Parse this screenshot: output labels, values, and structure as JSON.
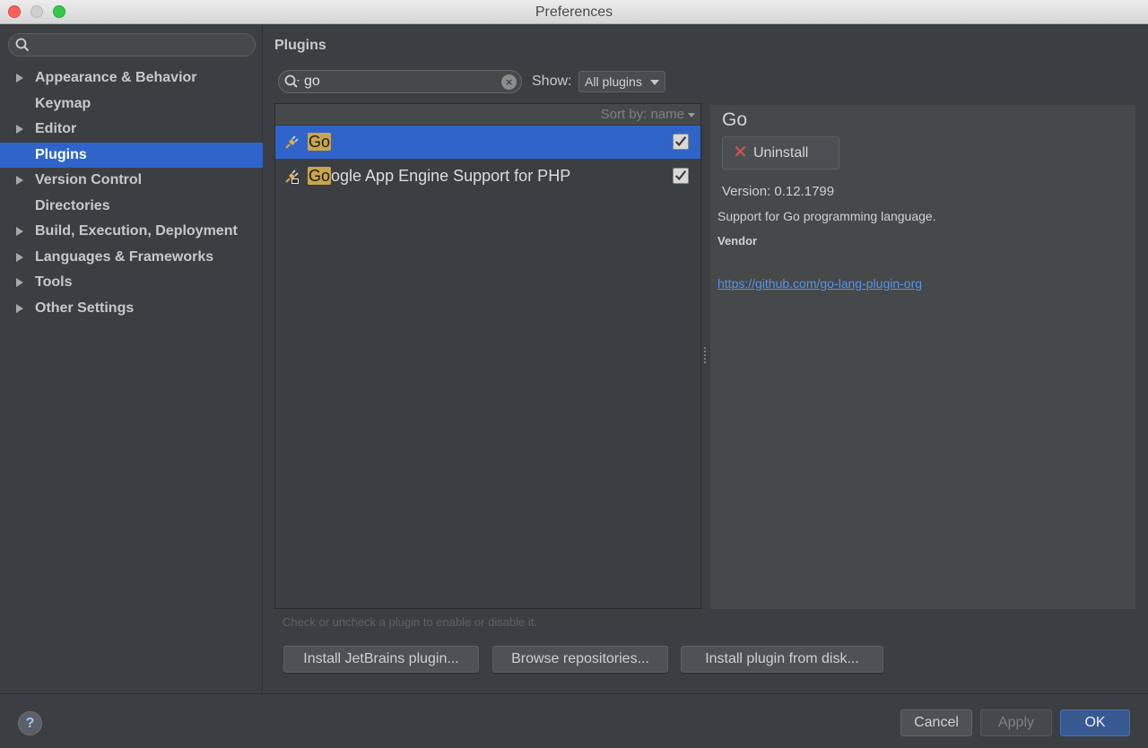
{
  "window": {
    "title": "Preferences"
  },
  "sidebar": {
    "search": {
      "value": "",
      "placeholder": ""
    },
    "items": [
      {
        "label": "Appearance & Behavior",
        "expandable": true,
        "selected": false
      },
      {
        "label": "Keymap",
        "expandable": false,
        "selected": false
      },
      {
        "label": "Editor",
        "expandable": true,
        "selected": false
      },
      {
        "label": "Plugins",
        "expandable": false,
        "selected": true
      },
      {
        "label": "Version Control",
        "expandable": true,
        "selected": false
      },
      {
        "label": "Directories",
        "expandable": false,
        "selected": false
      },
      {
        "label": "Build, Execution, Deployment",
        "expandable": true,
        "selected": false
      },
      {
        "label": "Languages & Frameworks",
        "expandable": true,
        "selected": false
      },
      {
        "label": "Tools",
        "expandable": true,
        "selected": false
      },
      {
        "label": "Other Settings",
        "expandable": true,
        "selected": false
      }
    ]
  },
  "plugins": {
    "title": "Plugins",
    "search": {
      "value": "go"
    },
    "show": {
      "label": "Show:",
      "selected": "All plugins"
    },
    "sort": {
      "label": "Sort by: name"
    },
    "list": [
      {
        "match": "Go",
        "rest": "",
        "checked": true,
        "selected": true,
        "icon": "plugin-plug-icon"
      },
      {
        "match": "Go",
        "rest": "ogle App Engine Support for PHP",
        "checked": true,
        "selected": false,
        "icon": "plugin-plug-bundled-icon"
      }
    ],
    "details": {
      "name": "Go",
      "uninstall_label": "Uninstall",
      "version": "Version: 0.12.1799",
      "description": "Support for Go programming language.",
      "vendor_label": "Vendor",
      "vendor_link": "https://github.com/go-lang-plugin-org"
    },
    "hint": "Check or uncheck a plugin to enable or disable it.",
    "buttons": {
      "install_jetbrains": "Install JetBrains plugin...",
      "browse_repositories": "Browse repositories...",
      "install_from_disk": "Install plugin from disk..."
    }
  },
  "footer": {
    "help_label": "?",
    "cancel_label": "Cancel",
    "apply_label": "Apply",
    "ok_label": "OK"
  },
  "colors": {
    "selection": "#2f65ca",
    "match_highlight": "#c9a54f",
    "link": "#5894e8",
    "uninstall_x": "#e0524b"
  }
}
